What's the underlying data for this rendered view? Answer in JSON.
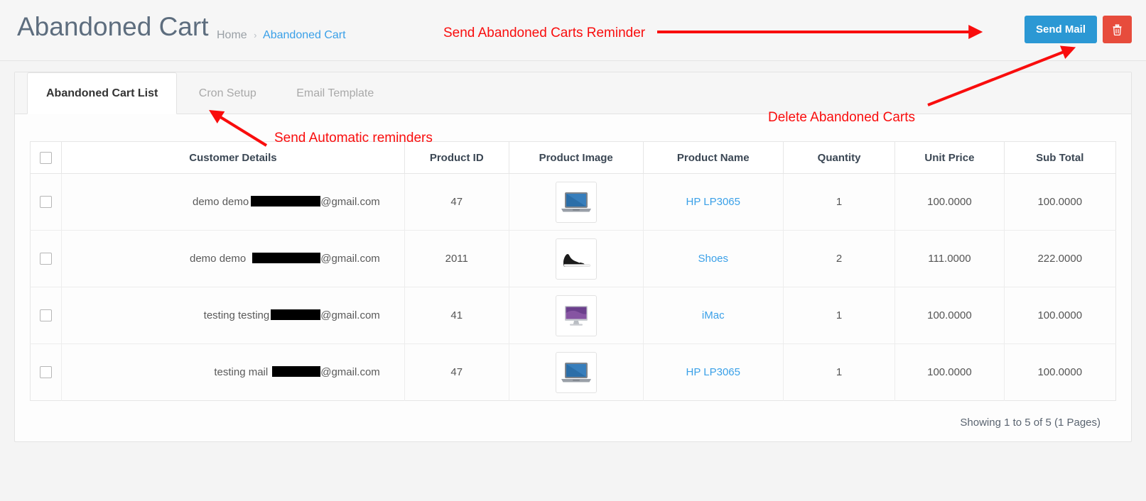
{
  "header": {
    "title": "Abandoned Cart",
    "breadcrumb": {
      "home": "Home",
      "separator": "›",
      "current": "Abandoned Cart"
    },
    "send_mail_label": "Send Mail",
    "delete_icon": "trash-icon",
    "accent_blue": "#2b98d4",
    "accent_red": "#e74c3c"
  },
  "tabs": [
    {
      "label": "Abandoned Cart List",
      "active": true
    },
    {
      "label": "Cron Setup",
      "active": false
    },
    {
      "label": "Email Template",
      "active": false
    }
  ],
  "table": {
    "columns": [
      "",
      "Customer Details",
      "Product ID",
      "Product Image",
      "Product Name",
      "Quantity",
      "Unit Price",
      "Sub Total"
    ],
    "rows": [
      {
        "customer_prefix": "demo demo",
        "customer_suffix": "@gmail.com",
        "customer_redacted": true,
        "product_id": "47",
        "product_image": "laptop-thumbnail",
        "product_name": "HP LP3065",
        "quantity": "1",
        "unit_price": "100.0000",
        "sub_total": "100.0000"
      },
      {
        "customer_prefix": "demo demo",
        "customer_suffix": "@gmail.com",
        "customer_redacted": true,
        "product_id": "2011",
        "product_image": "shoe-thumbnail",
        "product_name": "Shoes",
        "quantity": "2",
        "unit_price": "111.0000",
        "sub_total": "222.0000"
      },
      {
        "customer_prefix": "testing testing",
        "customer_suffix": "@gmail.com",
        "customer_redacted": true,
        "product_id": "41",
        "product_image": "imac-thumbnail",
        "product_name": "iMac",
        "quantity": "1",
        "unit_price": "100.0000",
        "sub_total": "100.0000"
      },
      {
        "customer_prefix": "testing mail",
        "customer_suffix": "@gmail.com",
        "customer_redacted": true,
        "product_id": "47",
        "product_image": "laptop-thumbnail",
        "product_name": "HP LP3065",
        "quantity": "1",
        "unit_price": "100.0000",
        "sub_total": "100.0000"
      }
    ],
    "pagination_text": "Showing 1 to 5 of 5 (1 Pages)"
  },
  "annotations": {
    "color": "#f90d0d",
    "reminder": "Send Abandoned Carts Reminder",
    "delete": "Delete Abandoned Carts",
    "automatic": "Send Automatic reminders"
  }
}
